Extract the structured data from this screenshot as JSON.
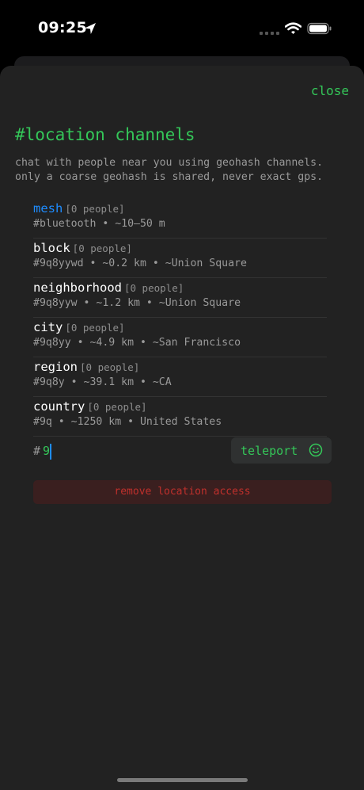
{
  "status_bar": {
    "time": "09:25"
  },
  "sheet": {
    "close_label": "close",
    "title": "#location channels",
    "description_lines": [
      "chat with people near you using geohash channels.",
      "only a coarse geohash is shared, never exact gps."
    ]
  },
  "channels": [
    {
      "name": "mesh",
      "count": "[0 people]",
      "detail": "#bluetooth • ~10–50 m",
      "active": true
    },
    {
      "name": "block",
      "count": "[0 people]",
      "detail": "#9q8yywd • ~0.2 km • ~Union Square",
      "active": false
    },
    {
      "name": "neighborhood",
      "count": "[0 people]",
      "detail": "#9q8yyw • ~1.2 km • ~Union Square",
      "active": false
    },
    {
      "name": "city",
      "count": "[0 people]",
      "detail": "#9q8yy • ~4.9 km • ~San Francisco",
      "active": false
    },
    {
      "name": "region",
      "count": "[0 people]",
      "detail": "#9q8y • ~39.1 km • ~CA",
      "active": false
    },
    {
      "name": "country",
      "count": "[0 people]",
      "detail": "#9q • ~1250 km • United States",
      "active": false
    }
  ],
  "teleport": {
    "hash_prefix": "#",
    "input_value": "9",
    "button_label": "teleport",
    "button_icon": "smiley-icon"
  },
  "remove_access_label": "remove location access",
  "colors": {
    "accent_green": "#34c759",
    "active_blue": "#1e8cff",
    "danger_red": "#c0302c",
    "sheet_bg": "#222222"
  }
}
